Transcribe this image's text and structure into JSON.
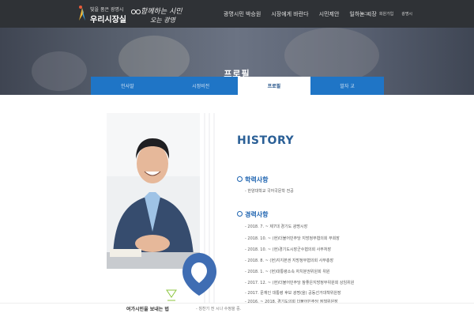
{
  "header": {
    "logo_small": "빛을 품은 광명시",
    "logo_title": "우리시장실",
    "slogan_line1": "함께하는 시민",
    "slogan_line2": "오는 광명",
    "nav": [
      "광명시민 박승원",
      "시장에게 바란다",
      "시민제안",
      "일하는 시장"
    ],
    "util": [
      "로그인",
      "회원가입",
      "광명시"
    ]
  },
  "hero": {
    "title": "프로필"
  },
  "tabs": [
    {
      "label": "인사말",
      "active": false
    },
    {
      "label": "시정비전",
      "active": false
    },
    {
      "label": "프로필",
      "active": true
    },
    {
      "label": "발자 교",
      "active": false
    }
  ],
  "profile": {
    "history_title": "HISTORY",
    "education_title": "학력사항",
    "education": [
      "- 한양대학교 국어국문학 전공"
    ],
    "career_title": "경력사항",
    "career": [
      "- 2018. 7. ~ 제7대 경기도 광명시장",
      "- 2018. 10. ~ (현)더불어민주당 지방정부협의회 부회장",
      "- 2018. 10. ~ (현)경기도시장군수협의회 사무처장",
      "- 2018. 8. ~ (현)지지본권 지방정부협의회 사무총장",
      "- 2018. 1. ~ (현)대통령소속 자치분권위원회 위원",
      "- 2017. 12. ~ (현)더불어민주당 참좋은지방정부위원회 상임위원",
      "- 2017. 문재인 대통령 후보 광명(을) 공동선거대책위원장",
      "- 2016. ~ 2018. 경기도의회 더불어민주당 정책위원장"
    ]
  },
  "footer": {
    "title": "여가시민을 보내는 법",
    "text": "- 칭찬기 전 시나 수정을 중."
  },
  "colors": {
    "header_bg": "#2f3236",
    "tab_blue": "#1f75c6",
    "heading_blue": "#2a5f96"
  }
}
